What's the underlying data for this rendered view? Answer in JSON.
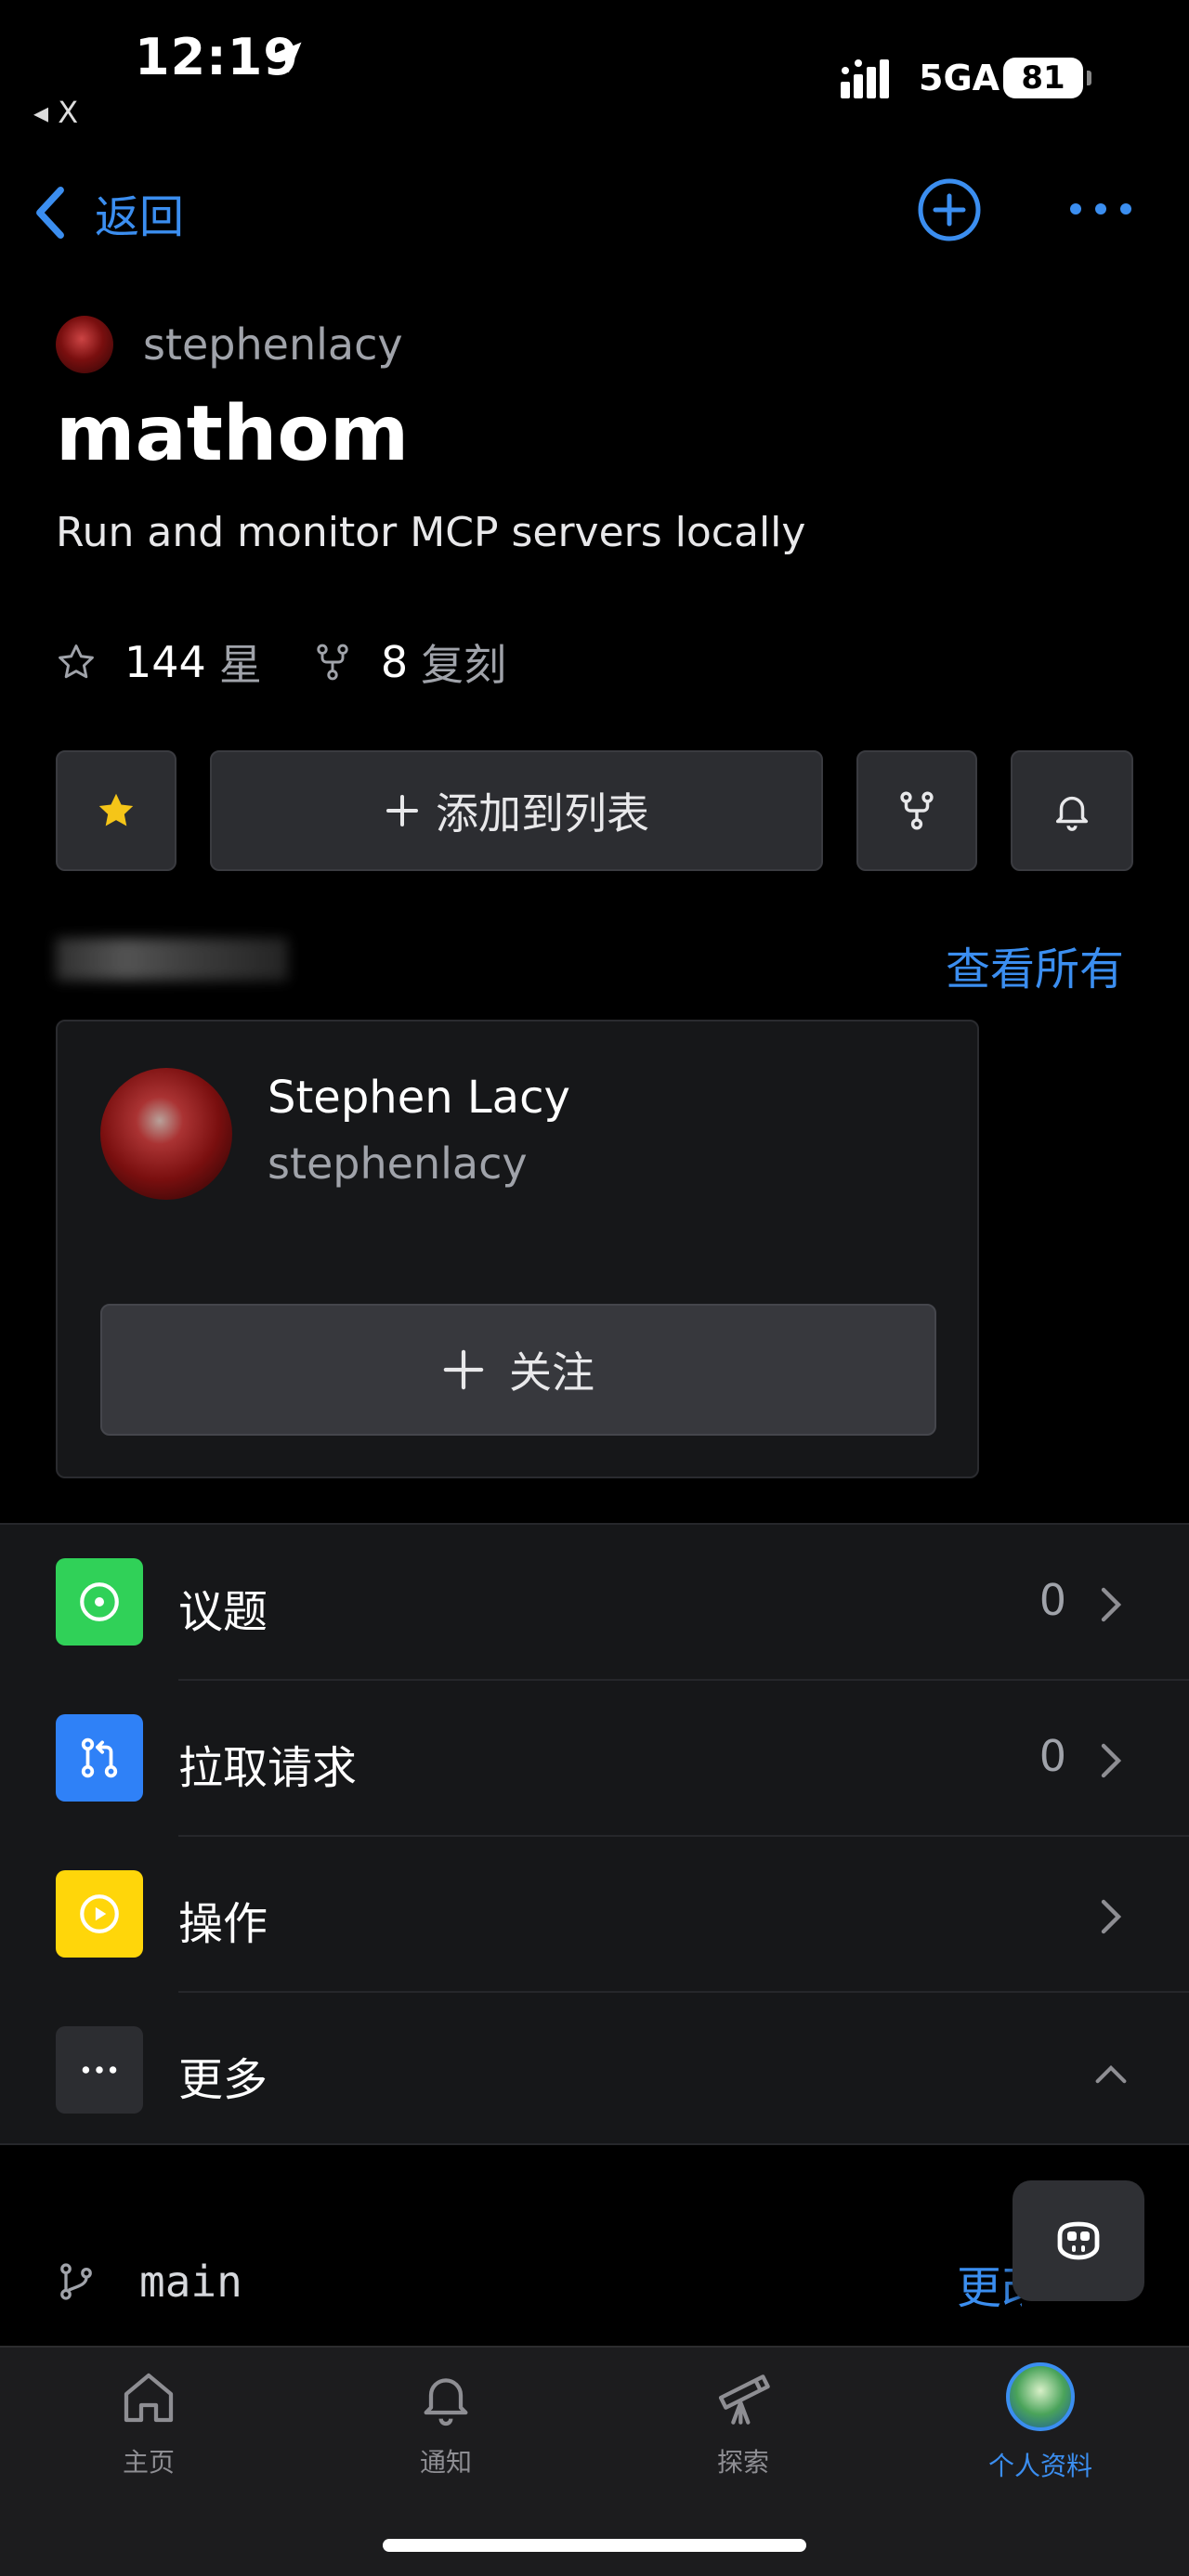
{
  "status_bar": {
    "time": "12:19",
    "back_app": "◂ X",
    "network": "5GA",
    "battery": "81"
  },
  "nav": {
    "back_label": "返回"
  },
  "repo": {
    "owner": "stephenlacy",
    "name": "mathom",
    "description": "Run and monitor MCP servers locally",
    "stars": "144",
    "stars_label": "星",
    "forks": "8",
    "forks_label": "复刻"
  },
  "actions": {
    "add_to_list": "添加到列表"
  },
  "contributors": {
    "view_all": "查看所有",
    "person": {
      "display_name": "Stephen Lacy",
      "login": "stephenlacy",
      "follow_label": "关注"
    }
  },
  "menu": {
    "items": [
      {
        "label": "议题",
        "count": "0",
        "icon": "issue-icon",
        "color": "#30d158"
      },
      {
        "label": "拉取请求",
        "count": "0",
        "icon": "pull-request-icon",
        "color": "#2f81f7"
      },
      {
        "label": "操作",
        "count": "",
        "icon": "actions-icon",
        "color": "#ffd60a"
      },
      {
        "label": "更多",
        "count": "",
        "icon": "more-icon",
        "color": "#2c2d31"
      }
    ]
  },
  "branch": {
    "name": "main",
    "change_label": "更改"
  },
  "tabbar": {
    "tabs": [
      {
        "label": "主页",
        "icon": "home-icon"
      },
      {
        "label": "通知",
        "icon": "bell-icon"
      },
      {
        "label": "探索",
        "icon": "telescope-icon"
      },
      {
        "label": "个人资料",
        "icon": "avatar"
      }
    ],
    "active": "个人资料"
  },
  "colors": {
    "accent": "#3b8ef0",
    "background": "#000000",
    "card": "#161719"
  }
}
